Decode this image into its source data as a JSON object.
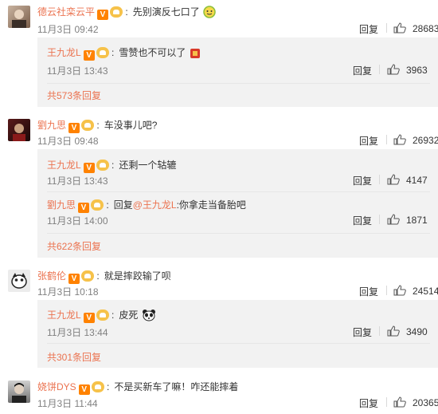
{
  "reply_label": "回复",
  "c1": {
    "user": "德云社栾云平",
    "text": "先别演反七口了",
    "time": "11月3日 09:42",
    "likes": "28683",
    "reply": {
      "user": "王九龙L",
      "text": "雪赞也不可以了",
      "time": "11月3日 13:43",
      "likes": "3963"
    },
    "more": "共573条回复"
  },
  "c2": {
    "user": "劉九思",
    "text": "车没事儿吧?",
    "time": "11月3日 09:48",
    "likes": "26932",
    "reply1": {
      "user": "王九龙L",
      "text": "还剩一个轱辘",
      "time": "11月3日 13:43",
      "likes": "4147"
    },
    "reply2": {
      "user": "劉九思",
      "prefix": "回复",
      "mention": "@王九龙L",
      "text": ":你拿走当备胎吧",
      "time": "11月3日 14:00",
      "likes": "1871"
    },
    "more": "共622条回复"
  },
  "c3": {
    "user": "张鹤伦",
    "text": "就是摔跤输了呗",
    "time": "11月3日 10:18",
    "likes": "24514",
    "reply": {
      "user": "王九龙L",
      "text": "皮死",
      "time": "11月3日 13:44",
      "likes": "3490"
    },
    "more": "共301条回复"
  },
  "c4": {
    "user": "娆饼DYS",
    "text": "不是买新车了嘛！咋还能摔着",
    "time": "11月3日 11:44",
    "likes": "20365"
  },
  "colors": {
    "accent": "#eb7350",
    "vip": "#ff8200",
    "sub_bg": "#f2f2f2"
  }
}
